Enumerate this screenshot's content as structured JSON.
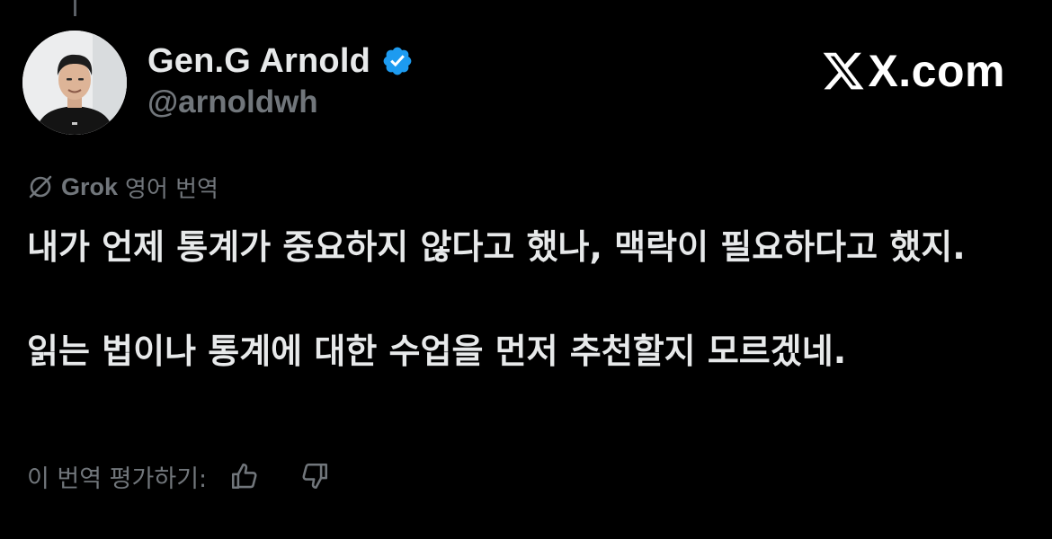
{
  "author": {
    "display_name": "Gen.G Arnold",
    "handle": "@arnoldwh",
    "verified": true,
    "verified_color": "#1d9bf0"
  },
  "watermark": {
    "text": "X.com"
  },
  "translation": {
    "provider": "Grok",
    "label": "영어 번역"
  },
  "tweet": {
    "paragraphs": [
      "내가 언제 통계가 중요하지 않다고 했나, 맥락이 필요하다고 했지.",
      "읽는 법이나 통계에 대한 수업을 먼저 추천할지 모르겠네."
    ]
  },
  "rating": {
    "prompt": "이 번역 평가하기:",
    "icons": [
      "thumbs-up-icon",
      "thumbs-down-icon"
    ]
  },
  "colors": {
    "background": "#000000",
    "text_primary": "#e7e9ea",
    "text_secondary": "#71767b"
  }
}
